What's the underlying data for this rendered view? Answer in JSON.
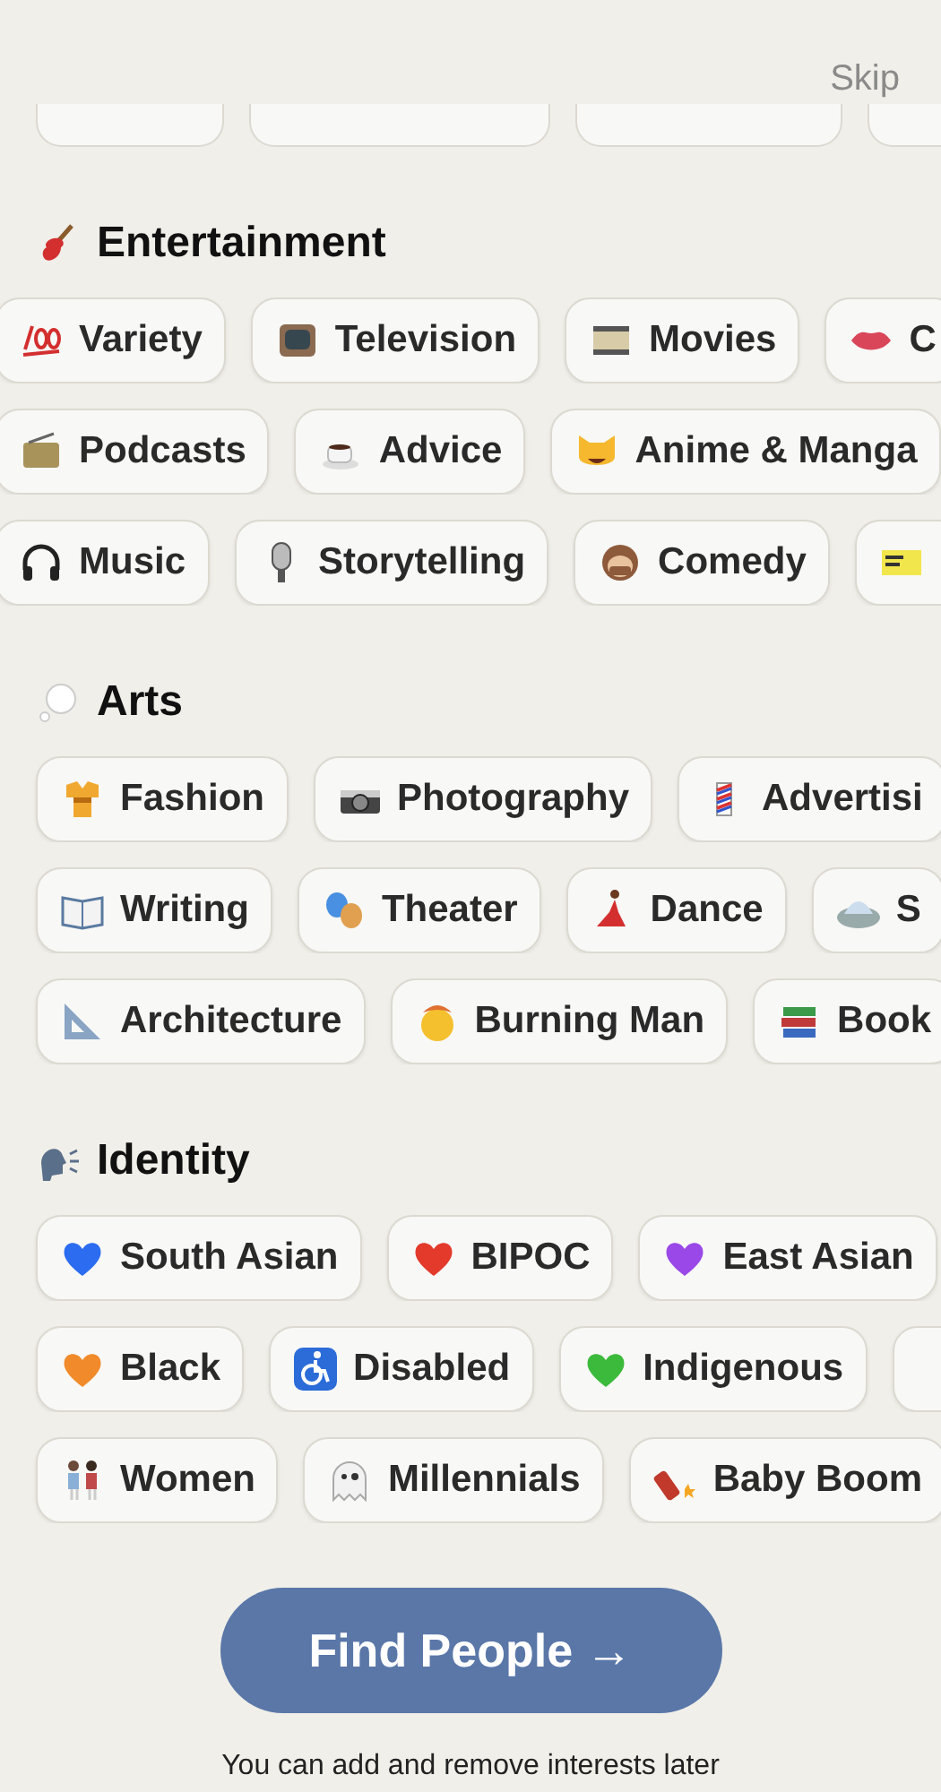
{
  "header": {
    "skip": "Skip"
  },
  "top_row": [
    {
      "kind": "blank"
    },
    {
      "kind": "blank"
    },
    {
      "kind": "blank"
    },
    {
      "kind": "blank"
    }
  ],
  "sections": [
    {
      "title": "Entertainment",
      "rows": [
        [
          {
            "kind": "labeled",
            "label": "Variety"
          },
          {
            "kind": "labeled",
            "label": "Television"
          },
          {
            "kind": "labeled",
            "label": "Movies"
          },
          {
            "kind": "labeled",
            "label": "C"
          }
        ],
        [
          {
            "kind": "labeled",
            "label": "Podcasts"
          },
          {
            "kind": "labeled",
            "label": "Advice"
          },
          {
            "kind": "labeled",
            "label": "Anime & Manga"
          }
        ],
        [
          {
            "kind": "labeled",
            "label": "Music"
          },
          {
            "kind": "labeled",
            "label": "Storytelling"
          },
          {
            "kind": "labeled",
            "label": "Comedy"
          },
          {
            "kind": "blank"
          }
        ]
      ]
    },
    {
      "title": "Arts",
      "rows": [
        [
          {
            "kind": "labeled",
            "label": "Fashion"
          },
          {
            "kind": "labeled",
            "label": "Photography"
          },
          {
            "kind": "labeled",
            "label": "Advertisi"
          }
        ],
        [
          {
            "kind": "labeled",
            "label": "Writing"
          },
          {
            "kind": "labeled",
            "label": "Theater"
          },
          {
            "kind": "labeled",
            "label": "Dance"
          },
          {
            "kind": "labeled",
            "label": "S"
          }
        ],
        [
          {
            "kind": "labeled",
            "label": "Architecture"
          },
          {
            "kind": "labeled",
            "label": "Burning Man"
          },
          {
            "kind": "labeled",
            "label": "Book"
          }
        ]
      ]
    },
    {
      "title": "Identity",
      "rows": [
        [
          {
            "kind": "labeled",
            "label": "South Asian"
          },
          {
            "kind": "labeled",
            "label": "BIPOC"
          },
          {
            "kind": "labeled",
            "label": "East Asian"
          }
        ],
        [
          {
            "kind": "labeled",
            "label": "Black"
          },
          {
            "kind": "labeled",
            "label": "Disabled"
          },
          {
            "kind": "labeled",
            "label": "Indigenous"
          },
          {
            "kind": "blank"
          }
        ],
        [
          {
            "kind": "labeled",
            "label": "Women"
          },
          {
            "kind": "labeled",
            "label": "Millennials"
          },
          {
            "kind": "labeled",
            "label": "Baby Boom"
          }
        ]
      ]
    }
  ],
  "button": {
    "label": "Find People →"
  },
  "footer": "You can add and remove interests later"
}
